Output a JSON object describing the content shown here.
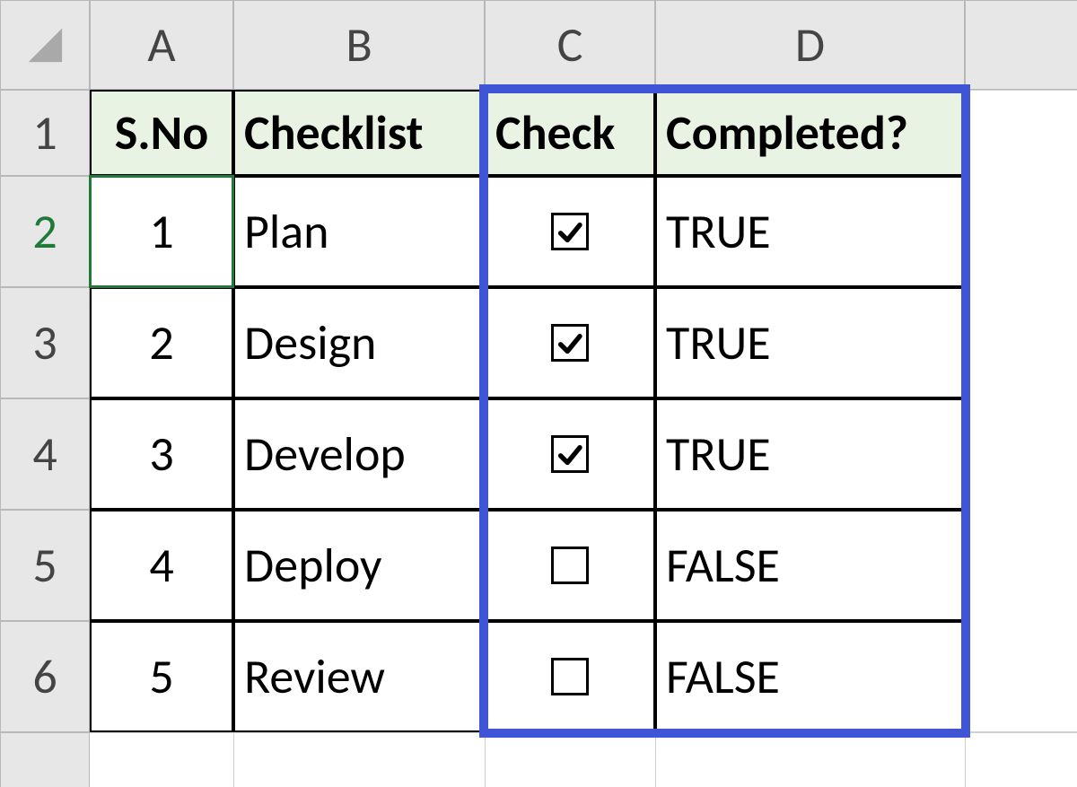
{
  "columns": [
    "A",
    "B",
    "C",
    "D"
  ],
  "row_numbers": [
    "1",
    "2",
    "3",
    "4",
    "5",
    "6"
  ],
  "headers": {
    "sno": "S.No",
    "checklist": "Checklist",
    "check": "Check",
    "completed": "Completed?"
  },
  "rows": [
    {
      "sno": "1",
      "checklist": "Plan",
      "checked": true,
      "completed": "TRUE"
    },
    {
      "sno": "2",
      "checklist": "Design",
      "checked": true,
      "completed": "TRUE"
    },
    {
      "sno": "3",
      "checklist": "Develop",
      "checked": true,
      "completed": "TRUE"
    },
    {
      "sno": "4",
      "checklist": "Deploy",
      "checked": false,
      "completed": "FALSE"
    },
    {
      "sno": "5",
      "checklist": "Review",
      "checked": false,
      "completed": "FALSE"
    }
  ],
  "active_cell": "A2",
  "highlight_range": "C1:D6"
}
